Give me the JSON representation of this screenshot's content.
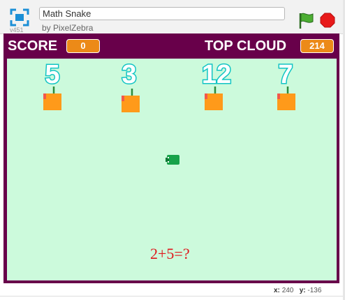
{
  "player": {
    "version": "v451",
    "project_title": "Math Snake",
    "author": "by PixelZebra"
  },
  "hud": {
    "score_label": "SCORE",
    "score_value": "0",
    "top_label": "TOP CLOUD",
    "top_value": "214"
  },
  "game": {
    "numbers": [
      "5",
      "3",
      "12",
      "7"
    ],
    "question": "2+5=?"
  },
  "coords": {
    "x_label": "x:",
    "x_value": "240",
    "y_label": "y:",
    "y_value": "-136"
  },
  "colors": {
    "stage_border": "#68004a",
    "playfield": "#ccfadc",
    "badge": "#ec8a18",
    "number_outline": "#12c4c4",
    "fruit": "#ff9a1a",
    "question_text": "#e0161b"
  },
  "icons": [
    "fullscreen-icon",
    "green-flag-icon",
    "stop-icon",
    "fruit-icon",
    "snake-icon"
  ]
}
